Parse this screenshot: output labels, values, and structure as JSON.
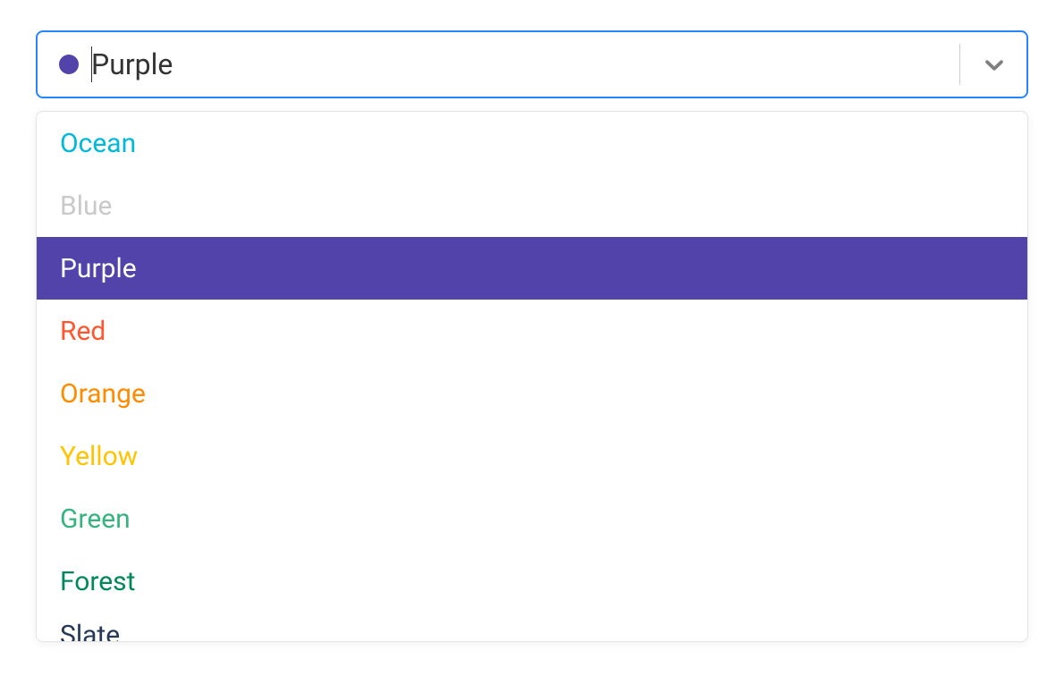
{
  "select": {
    "selected_label": "Purple",
    "selected_color": "#5243aa",
    "caret_visible": true
  },
  "options": [
    {
      "label": "Ocean",
      "color": "#00b8d9",
      "selected": false,
      "disabled": false
    },
    {
      "label": "Blue",
      "color": "#c9c9c9",
      "selected": false,
      "disabled": true
    },
    {
      "label": "Purple",
      "color": "#5243aa",
      "selected": true,
      "disabled": false
    },
    {
      "label": "Red",
      "color": "#ff5630",
      "selected": false,
      "disabled": false
    },
    {
      "label": "Orange",
      "color": "#ff8b00",
      "selected": false,
      "disabled": false
    },
    {
      "label": "Yellow",
      "color": "#ffc400",
      "selected": false,
      "disabled": false
    },
    {
      "label": "Green",
      "color": "#36b37e",
      "selected": false,
      "disabled": false
    },
    {
      "label": "Forest",
      "color": "#00875a",
      "selected": false,
      "disabled": false
    },
    {
      "label": "Slate",
      "color": "#253858",
      "selected": false,
      "disabled": false,
      "partial": true
    }
  ]
}
